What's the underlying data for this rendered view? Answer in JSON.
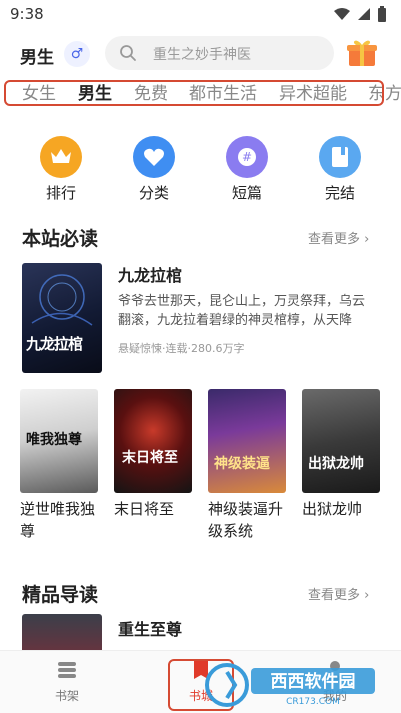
{
  "status_bar": {
    "time": "9:38"
  },
  "header": {
    "gender_title": "男生",
    "gender_icon": "male-symbol-icon",
    "search_placeholder": "重生之妙手神医"
  },
  "tabs": [
    {
      "label": "女生",
      "active": false
    },
    {
      "label": "男生",
      "active": true
    },
    {
      "label": "免费",
      "active": false
    },
    {
      "label": "都市生活",
      "active": false
    },
    {
      "label": "异术超能",
      "active": false
    },
    {
      "label": "东方",
      "active": false
    }
  ],
  "categories": [
    {
      "label": "排行",
      "icon": "crown-icon",
      "color": "#f6a623"
    },
    {
      "label": "分类",
      "icon": "heart-icon",
      "color": "#3f8ef2"
    },
    {
      "label": "短篇",
      "icon": "hash-icon",
      "color": "#8a7cf0"
    },
    {
      "label": "完结",
      "icon": "book-icon",
      "color": "#5aa8f0"
    }
  ],
  "must_read": {
    "title": "本站必读",
    "more": "查看更多",
    "featured": {
      "title": "九龙拉棺",
      "description": "爷爷去世那天，昆仑山上，万灵祭拜，乌云翻滚，九龙拉着碧绿的神灵棺椁，从天降",
      "meta": "悬疑惊悚·连载·280.6万字",
      "cover_text": "九龙拉棺"
    },
    "books": [
      {
        "title": "逆世唯我独尊",
        "cover_text": "唯我独尊"
      },
      {
        "title": "末日将至",
        "cover_text": "末日将至"
      },
      {
        "title": "神级装逼升级系统",
        "cover_text": "神级装逼"
      },
      {
        "title": "出狱龙帅",
        "cover_text": "出狱龙帅"
      }
    ]
  },
  "recommend": {
    "title": "精品导读",
    "more": "查看更多",
    "first_book": "重生至尊"
  },
  "bottom_nav": [
    {
      "label": "书架",
      "icon": "bookshelf-icon",
      "active": false
    },
    {
      "label": "书城",
      "icon": "bookstore-icon",
      "active": true
    },
    {
      "label": "我的",
      "icon": "profile-icon",
      "active": false
    }
  ],
  "watermark": {
    "text": "西西软件园",
    "subtext": "CR173.COM"
  },
  "colors": {
    "highlight": "#d54a33",
    "accent": "#e03a2a"
  }
}
